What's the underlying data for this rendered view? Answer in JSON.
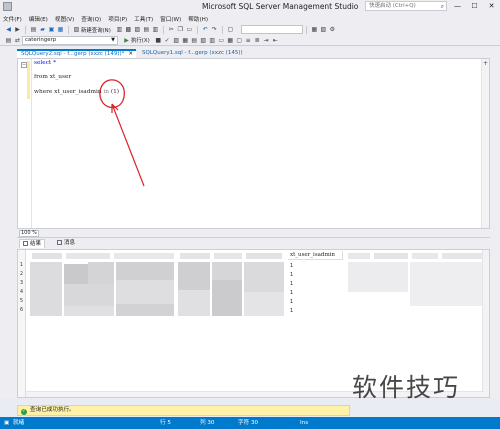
{
  "window": {
    "title": "Microsoft SQL Server Management Studio",
    "quick_launch_placeholder": "快速启动 (Ctrl+Q)"
  },
  "menu": [
    "文件(F)",
    "编辑(E)",
    "视图(V)",
    "查询(Q)",
    "项目(P)",
    "工具(T)",
    "窗口(W)",
    "帮助(H)"
  ],
  "toolbar": {
    "new_query": "新建查询(N)",
    "database": "cateringerp",
    "execute": "执行(X)"
  },
  "tabs": {
    "active": "SQLQuery2.sql - f...gerp (xxzc (149))*",
    "inactive": "SQLQuery1.sql - f...gerp (xxzc (145))"
  },
  "editor": {
    "line1": "select *",
    "line2": "from xt_user",
    "line3_keyword": "where",
    "line3_rest": " xt_user_isadmin ",
    "line3_in": "in",
    "line3_value": " (1)"
  },
  "zoom": "100 %",
  "results": {
    "tab_results": "结果",
    "tab_messages": "消息",
    "column_header": "xt_user_isadmin",
    "row_numbers": [
      "1",
      "2",
      "3",
      "4",
      "5",
      "6"
    ],
    "values": [
      "1",
      "1",
      "1",
      "1",
      "1",
      "1"
    ]
  },
  "status": {
    "query_ok": "查询已成功执行。",
    "ready": "就绪",
    "line": "行 5",
    "column": "列 30",
    "character": "字符 30",
    "insert": "Ins"
  },
  "watermark": "软件技巧",
  "colors": {
    "accent": "#007acc",
    "keyword": "#0000ff",
    "annotation": "#d9242b",
    "success_bar": "#fff1a8"
  }
}
